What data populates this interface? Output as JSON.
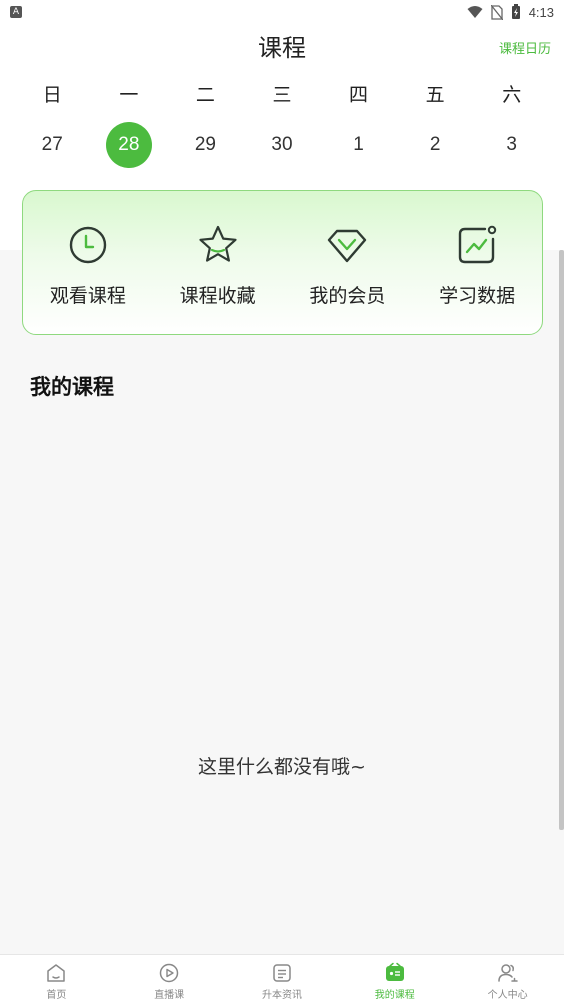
{
  "status_bar": {
    "notification_glyph": "A",
    "time": "4:13",
    "icons": [
      "wifi-icon",
      "no-sim-icon",
      "battery-charging-icon"
    ]
  },
  "header": {
    "title": "课程",
    "calendar_link": "课程日历"
  },
  "week": {
    "days": [
      "日",
      "一",
      "二",
      "三",
      "四",
      "五",
      "六"
    ],
    "dates": [
      "27",
      "28",
      "29",
      "30",
      "1",
      "2",
      "3"
    ],
    "selected_index": 1
  },
  "quick_actions": [
    {
      "label": "观看课程",
      "icon": "clock-icon"
    },
    {
      "label": "课程收藏",
      "icon": "star-icon"
    },
    {
      "label": "我的会员",
      "icon": "diamond-icon"
    },
    {
      "label": "学习数据",
      "icon": "chart-icon"
    }
  ],
  "my_courses": {
    "title": "我的课程",
    "empty_text": "这里什么都没有哦~"
  },
  "bottom_nav": [
    {
      "label": "首页",
      "icon": "home-icon",
      "active": false
    },
    {
      "label": "直播课",
      "icon": "play-circle-icon",
      "active": false
    },
    {
      "label": "升本资讯",
      "icon": "news-icon",
      "active": false
    },
    {
      "label": "我的课程",
      "icon": "my-courses-icon",
      "active": true
    },
    {
      "label": "个人中心",
      "icon": "user-icon",
      "active": false
    }
  ],
  "colors": {
    "accent": "#4cbb3f",
    "icon_dark": "#2f3b33",
    "nav_inactive": "#888888"
  }
}
